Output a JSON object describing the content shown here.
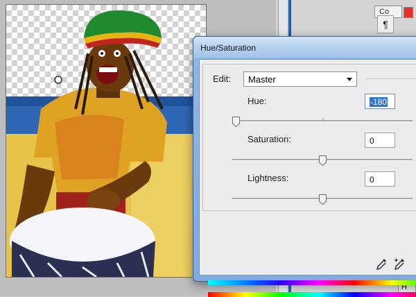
{
  "dialog": {
    "title": "Hue/Saturation",
    "edit": {
      "label": "Edit:",
      "selected": "Master"
    },
    "hue": {
      "label": "Hue:",
      "value": "-180",
      "slider_fraction": 0.0
    },
    "saturation": {
      "label": "Saturation:",
      "value": "0",
      "slider_fraction": 0.5
    },
    "lightness": {
      "label": "Lightness:",
      "value": "0",
      "slider_fraction": 0.5
    }
  },
  "panels": {
    "tab_label": "Co",
    "paragraph_glyph": "¶",
    "bottom_tab_label": "H"
  },
  "icons": [
    "eyedropper-icon",
    "eyedropper-plus-icon",
    "dropdown-caret-icon",
    "paragraph-icon"
  ]
}
